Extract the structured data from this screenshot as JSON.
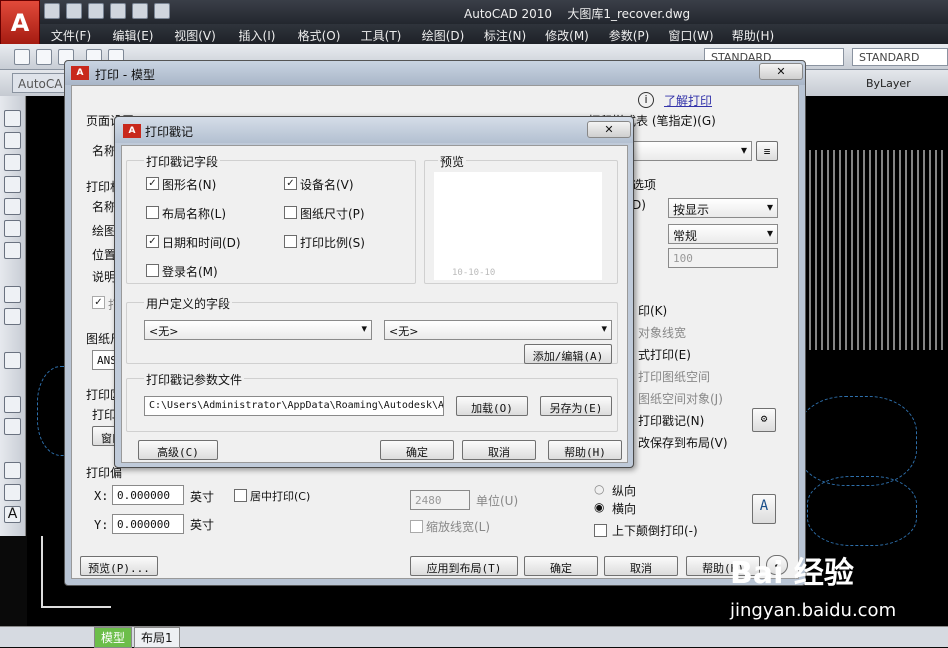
{
  "app": {
    "title": "AutoCAD 2010",
    "filename": "大图库1_recover.dwg",
    "logo_letter": "A"
  },
  "menu": [
    "文件(F)",
    "编辑(E)",
    "视图(V)",
    "插入(I)",
    "格式(O)",
    "工具(T)",
    "绘图(D)",
    "标注(N)",
    "修改(M)",
    "参数(P)",
    "窗口(W)",
    "帮助(H)"
  ],
  "toolbar": {
    "style1": "STANDARD",
    "style2": "STANDARD",
    "bylayer": "ByLayer",
    "file_tab": "AutoCA"
  },
  "layout_tabs": [
    "模型",
    "布局1"
  ],
  "plot": {
    "title": "打印 - 模型",
    "learn_link": "了解打印",
    "page_setup": "页面设置",
    "name": "名称",
    "plotter": "打印机",
    "name2": "名称",
    "plotter_label": "绘图",
    "location": "位置",
    "desc": "说明",
    "plot_to_file": "打",
    "paper_size": "图纸尺",
    "paper_value": "ANSI",
    "plot_area": "打印区",
    "plot_range": "打印范",
    "window_btn": "窗口",
    "offset": "打印偏",
    "x_label": "X:",
    "x_value": "0.000000",
    "y_label": "Y:",
    "y_value": "0.000000",
    "unit": "英寸",
    "center_plot": "居中打印(C)",
    "style_table": "打印样式表 (笔指定)(G)",
    "shaded_options": "选项",
    "shade_letter": "D)",
    "shade_display": "按显示",
    "quality": "常规",
    "dpi": "100",
    "opt_bg": "印(K)",
    "opt_lineweight": "对象线宽",
    "opt_transparency": "式打印(E)",
    "opt_paperspace_last": "打印图纸空间",
    "opt_hide": "图纸空间对象(J)",
    "opt_stamp": "打印戳记(N)",
    "opt_save": "改保存到布局(V)",
    "orientation_portrait": "纵向",
    "orientation_landscape": "横向",
    "upside_down": "上下颠倒打印(-)",
    "scale_value": "2480",
    "scale_unit": "单位(U)",
    "scale_lineweights": "缩放线宽(L)",
    "preview_btn": "预览(P)...",
    "apply_btn": "应用到布局(T)",
    "ok_btn": "确定",
    "cancel_btn": "取消",
    "help_btn": "帮助(H)"
  },
  "stamp": {
    "title": "打印戳记",
    "fields_group": "打印戳记字段",
    "fields": [
      {
        "label": "图形名(N)",
        "checked": true
      },
      {
        "label": "设备名(V)",
        "checked": true
      },
      {
        "label": "布局名称(L)",
        "checked": false
      },
      {
        "label": "图纸尺寸(P)",
        "checked": false
      },
      {
        "label": "日期和时间(D)",
        "checked": true
      },
      {
        "label": "打印比例(S)",
        "checked": false
      },
      {
        "label": "登录名(M)",
        "checked": false
      }
    ],
    "preview_group": "预览",
    "preview_text": "10-10-10",
    "user_fields_group": "用户定义的字段",
    "user_field_1": "<无>",
    "user_field_2": "<无>",
    "add_edit_btn": "添加/编辑(A)",
    "param_file_group": "打印戳记参数文件",
    "param_path": "C:\\Users\\Administrator\\AppData\\Roaming\\Autodesk\\A",
    "load_btn": "加载(O)",
    "save_as_btn": "另存为(E)",
    "advanced_btn": "高级(C)",
    "ok_btn": "确定",
    "cancel_btn": "取消",
    "help_btn": "帮助(H)"
  },
  "watermark": {
    "brand": "Bai 经验",
    "url": "jingyan.baidu.com"
  }
}
